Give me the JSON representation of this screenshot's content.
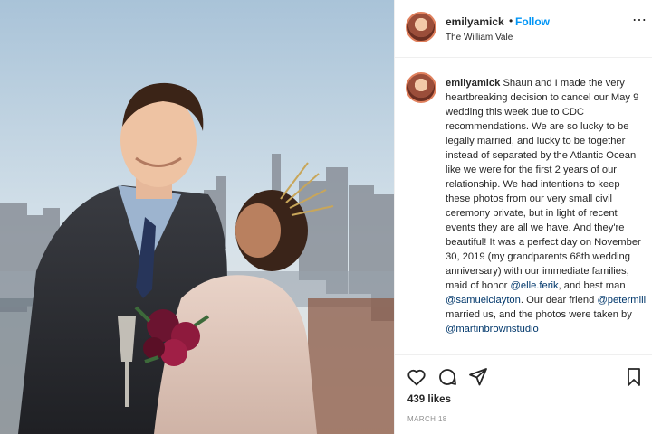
{
  "header": {
    "username": "emilyamick",
    "separator": "•",
    "follow_label": "Follow",
    "location": "The William Vale",
    "more_icon": "more-dots-icon"
  },
  "caption": {
    "username": "emilyamick",
    "part1": " Shaun and I made the very heartbreaking decision to cancel our May 9 wedding this week due to CDC recommendations. We are so lucky to be legally married, and lucky to be together instead of separated by the Atlantic Ocean like we were for the first 2 years of our relationship. We had intentions to keep these photos from our very small civil ceremony private, but in light of recent events they are all we have. And they're beautiful! It was a perfect day on November 30, 2019 (my grandparents 68th wedding anniversary) with our immediate families, maid of honor ",
    "mention1": "@elle.ferik",
    "part2": ", and best man ",
    "mention2": "@samuelclayton",
    "part3": ". Our dear friend ",
    "mention3": "@petermill",
    "part4": " married us, and the photos were taken by ",
    "mention4": "@martinbrownstudio"
  },
  "actions": {
    "icons": [
      "heart-icon",
      "comment-icon",
      "share-icon",
      "bookmark-icon"
    ],
    "likes": "439 likes",
    "date": "MARCH 18"
  },
  "colors": {
    "link_blue": "#0095f6",
    "mention_blue": "#00376b",
    "muted_gray": "#8e8e8e",
    "divider": "#efefef"
  }
}
